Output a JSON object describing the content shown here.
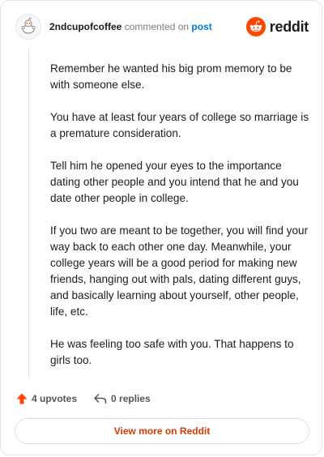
{
  "header": {
    "username": "2ndcupofcoffee",
    "action_text": "commented on",
    "post_link": "post",
    "brand": "reddit"
  },
  "comment": {
    "paragraphs": [
      "Remember he wanted his big prom memory to be with someone else.",
      "You have at least four years of college so marriage is a premature consideration.",
      "Tell him he opened your eyes to the importance dating other people and you intend that he and you date other people in college.",
      "If you two are meant to be together, you will find your way back to each other one day. Meanwhile, your college years will be a good period for making new friends, hanging out with pals, dating different guys, and basically learning about yourself, other people, life, etc.",
      "He was feeling too safe with you. That happens to girls too."
    ]
  },
  "actions": {
    "upvotes_label": "4 upvotes",
    "replies_label": "0 replies"
  },
  "footer": {
    "view_more_label": "View more on Reddit"
  },
  "colors": {
    "brand_orange": "#ff4500",
    "link_blue": "#0079d3",
    "cta_text": "#d93a00"
  },
  "icons": {
    "avatar": "snoo-avatar-icon",
    "logo": "reddit-logo-icon",
    "upvote": "upvote-arrow-icon",
    "reply": "reply-arrow-icon"
  }
}
